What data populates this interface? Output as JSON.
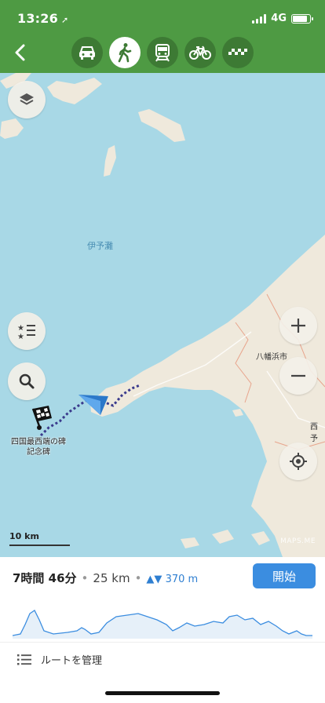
{
  "status": {
    "time": "13:26",
    "network": "4G"
  },
  "header": {
    "back_label": "back",
    "modes": [
      {
        "name": "car",
        "active": false
      },
      {
        "name": "walk",
        "active": true
      },
      {
        "name": "train",
        "active": false
      },
      {
        "name": "bicycle",
        "active": false
      },
      {
        "name": "taxi",
        "active": false
      }
    ]
  },
  "map": {
    "sea_label": "伊予灘",
    "city_label_1": "八幡浜市",
    "city_label_2": "西予",
    "destination_label": "四国最西端の碑\n記念碑",
    "scale_label": "10 km",
    "watermark": "MAPS.ME"
  },
  "route": {
    "duration": "7時間 46分",
    "separator": "•",
    "distance": "25 km",
    "elevation": "370 m",
    "elevation_arrows": "▲▼",
    "start_button": "開始"
  },
  "manage": {
    "label": "ルートを管理"
  },
  "colors": {
    "header": "#4e9a43",
    "water": "#a8d8e6",
    "land": "#efe9dc",
    "accent": "#3b8de0",
    "route": "#3a3a8c"
  }
}
